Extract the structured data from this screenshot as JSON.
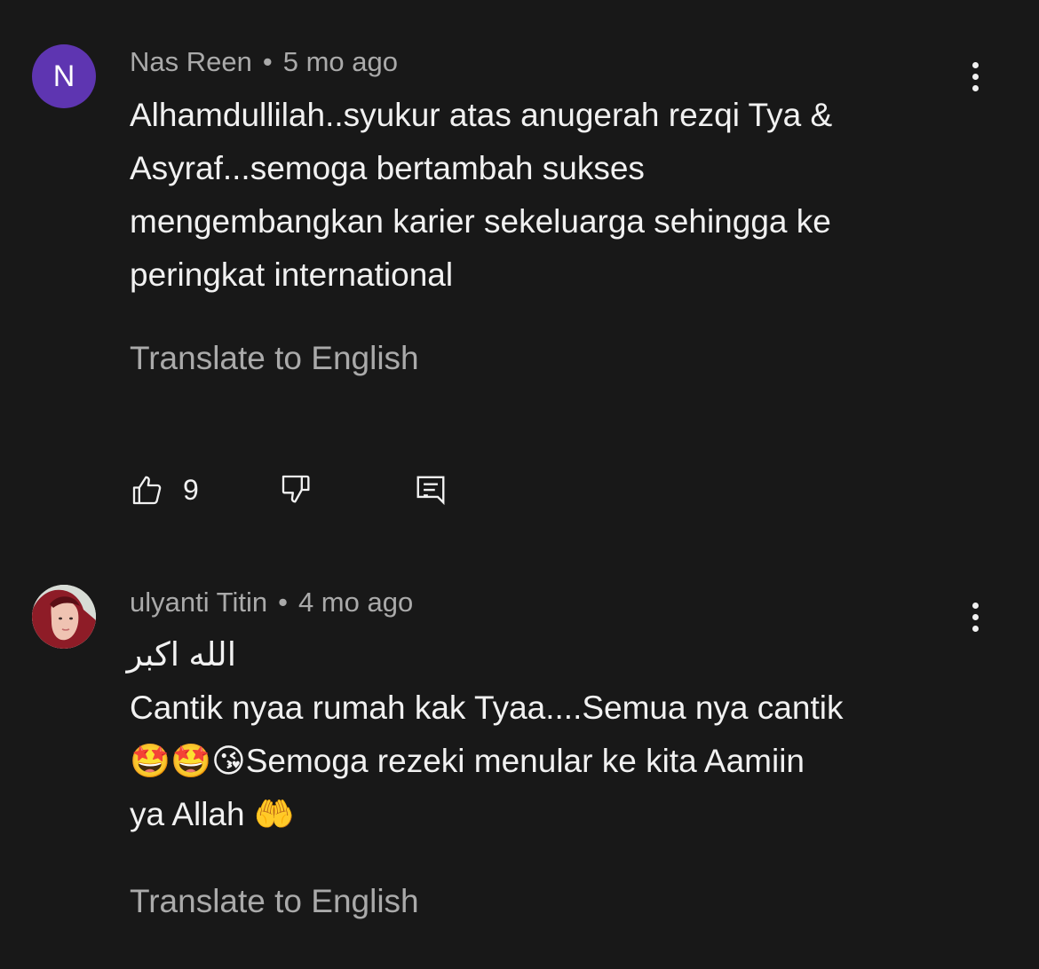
{
  "comments": [
    {
      "avatar_letter": "N",
      "author": "Nas Reen",
      "separator": "•",
      "time": "5 mo ago",
      "lines": [
        "Alhamdullilah..syukur atas anugerah rezqi Tya &",
        "Asyraf...semoga bertambah sukses",
        "mengembangkan karier sekeluarga sehingga ke",
        "peringkat international"
      ],
      "translate_label": "Translate to English",
      "like_count": "9"
    },
    {
      "author": "ulyanti Titin",
      "separator": "•",
      "time": "4 mo ago",
      "lines": [
        "الله اكبر",
        "Cantik nyaa rumah kak Tyaa....Semua nya cantik",
        "🤩🤩😘Semoga rezeki menular ke kita Aamiin",
        "ya Allah 🤲"
      ],
      "translate_label": "Translate to English"
    }
  ],
  "icons": {
    "like": "thumbs-up-icon",
    "dislike": "thumbs-down-icon",
    "reply": "reply-comment-icon",
    "more": "more-vertical-icon"
  },
  "colors": {
    "background": "#181818",
    "primary_text": "#f1f1f1",
    "secondary_text": "#aaaaaa",
    "avatar_purple": "#5e35b1"
  }
}
